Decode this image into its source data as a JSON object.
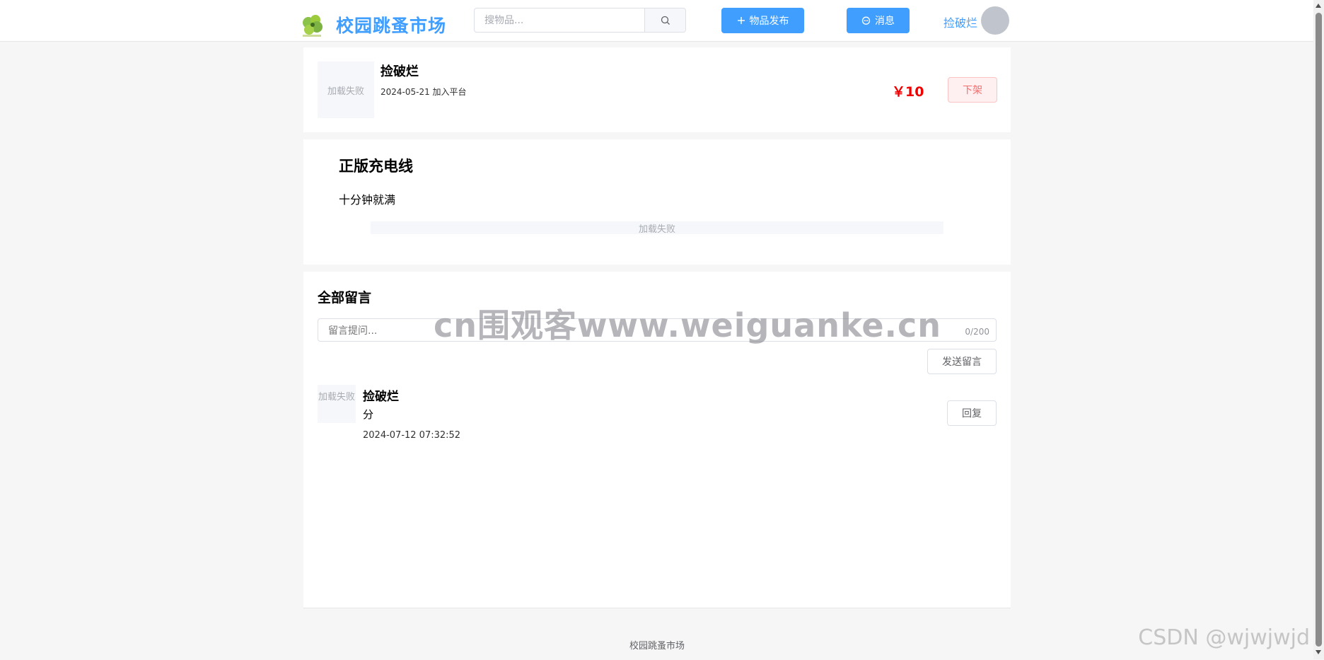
{
  "header": {
    "brand": "校园跳蚤市场",
    "search_placeholder": "搜物品...",
    "publish_label": "物品发布",
    "message_label": "消息",
    "user_name": "捡破烂"
  },
  "seller": {
    "image_fail_text": "加载失败",
    "name": "捡破烂",
    "joined": "2024-05-21 加入平台",
    "price": "￥10",
    "offshelf_label": "下架"
  },
  "item": {
    "title": "正版充电线",
    "description": "十分钟就满",
    "image_fail_text": "加载失败"
  },
  "comments": {
    "title": "全部留言",
    "input_placeholder": "留言提问...",
    "counter": "0/200",
    "send_label": "发送留言",
    "list": [
      {
        "avatar_fail_text": "加载失败",
        "author": "捡破烂",
        "content": "分",
        "time": "2024-07-12 07:32:52",
        "reply_label": "回复"
      }
    ]
  },
  "footer": {
    "text": "校园跳蚤市场"
  },
  "overlays": {
    "watermark": "cn围观客www.weiguanke.cn",
    "csdn": "CSDN @wjwjwjd"
  },
  "colors": {
    "primary": "#409eff",
    "price": "#f00000",
    "danger_bg": "#fef0f0"
  }
}
